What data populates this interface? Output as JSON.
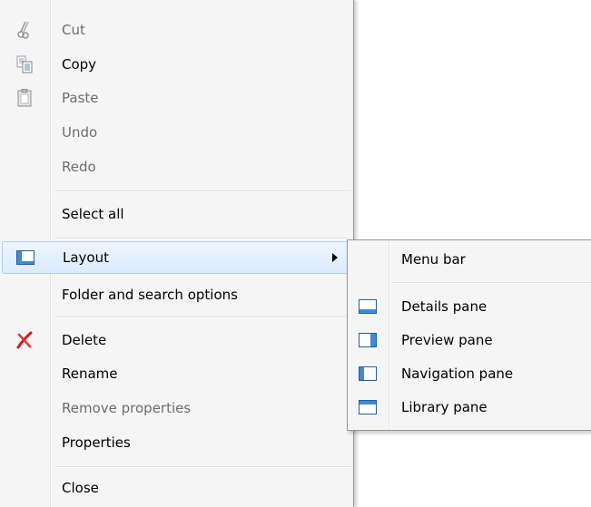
{
  "menu": {
    "items": [
      {
        "label": "Cut",
        "disabled": true,
        "icon": "scissors-icon"
      },
      {
        "label": "Copy",
        "disabled": false,
        "icon": "copy-icon"
      },
      {
        "label": "Paste",
        "disabled": true,
        "icon": "paste-icon"
      },
      {
        "label": "Undo",
        "disabled": true
      },
      {
        "label": "Redo",
        "disabled": true
      },
      {
        "label": "Select all",
        "disabled": false
      },
      {
        "label": "Layout",
        "disabled": false,
        "icon": "layout-icon",
        "submenu": true,
        "highlighted": true
      },
      {
        "label": "Folder and search options",
        "disabled": false
      },
      {
        "label": "Delete",
        "disabled": false,
        "icon": "delete-x-icon"
      },
      {
        "label": "Rename",
        "disabled": false
      },
      {
        "label": "Remove properties",
        "disabled": true
      },
      {
        "label": "Properties",
        "disabled": false
      },
      {
        "label": "Close",
        "disabled": false
      }
    ]
  },
  "layout_submenu": {
    "items": [
      {
        "label": "Menu bar",
        "icon": ""
      },
      {
        "label": "Details pane",
        "icon": "details-pane-icon"
      },
      {
        "label": "Preview pane",
        "icon": "preview-pane-icon"
      },
      {
        "label": "Navigation pane",
        "icon": "navigation-pane-icon"
      },
      {
        "label": "Library pane",
        "icon": "library-pane-icon"
      }
    ]
  },
  "colors": {
    "menu_background": "#f5f5f5",
    "highlight_border": "#aecff7",
    "disabled_text": "#6d6d6d",
    "pane_icon_blue": "#3d8bd3",
    "delete_red": "#d11a1a"
  }
}
